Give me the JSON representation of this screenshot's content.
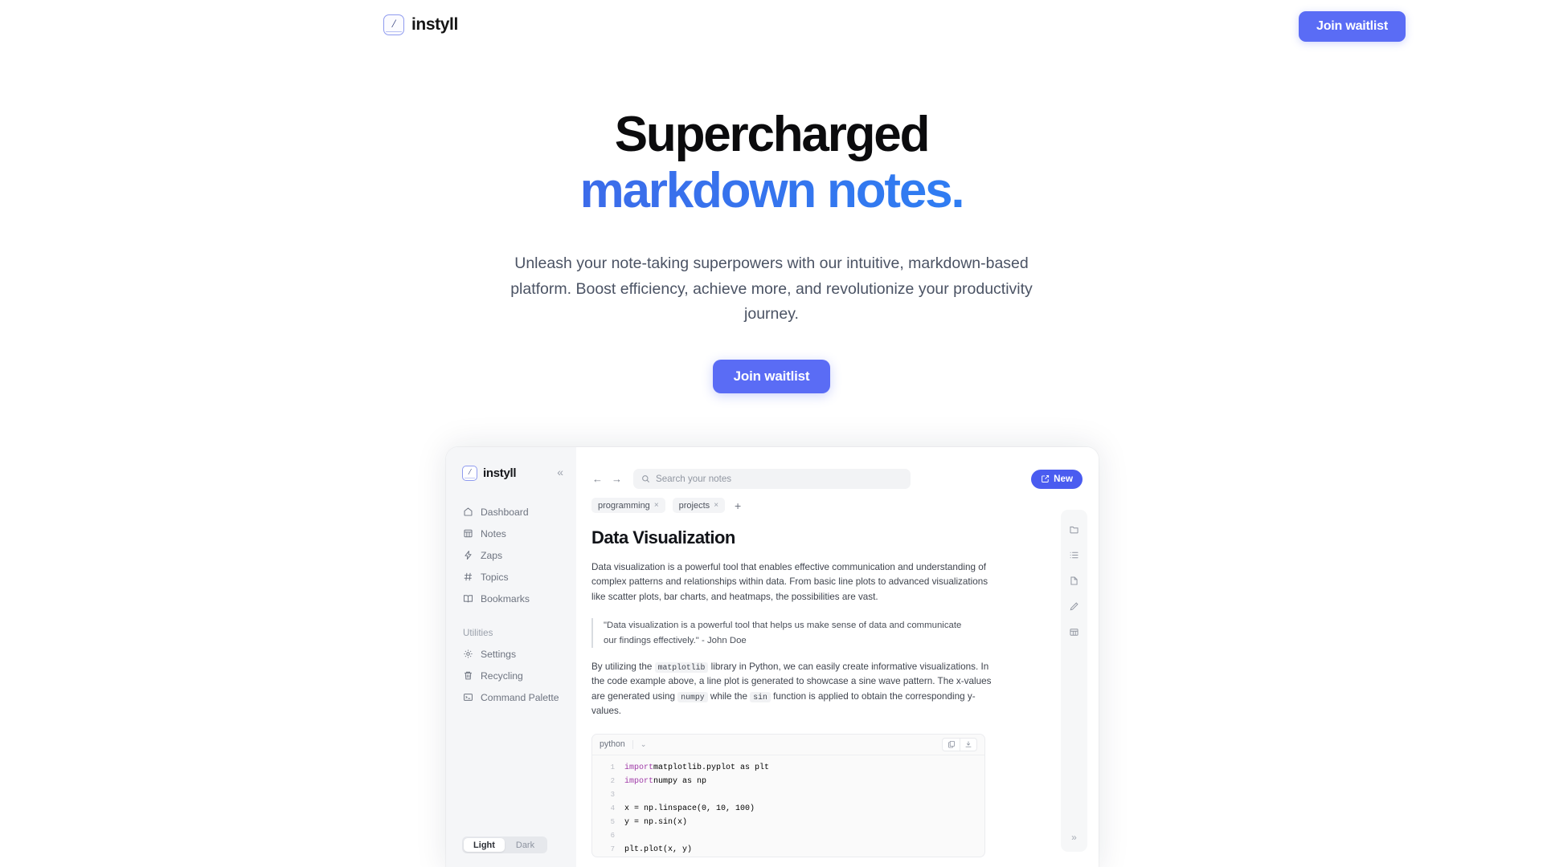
{
  "site": {
    "brand_name": "instyll",
    "logo_glyph": "/",
    "nav_cta_label": "Join waitlist"
  },
  "hero": {
    "headline_line1": "Supercharged",
    "headline_line2": "markdown notes.",
    "subheadline": "Unleash your note-taking superpowers with our intuitive, markdown-based platform. Boost efficiency, achieve more, and revolutionize your productivity journey.",
    "cta_label": "Join waitlist",
    "accent_color": "#5a6cf5",
    "gradient_from": "#2f4fd8",
    "gradient_to": "#1b8df8"
  },
  "app": {
    "brand_name": "instyll",
    "logo_glyph": "/",
    "collapse_icon": "«",
    "nav_items": [
      {
        "label": "Dashboard",
        "icon": "home-icon"
      },
      {
        "label": "Notes",
        "icon": "grid-icon"
      },
      {
        "label": "Zaps",
        "icon": "lightning-icon"
      },
      {
        "label": "Topics",
        "icon": "hash-icon"
      },
      {
        "label": "Bookmarks",
        "icon": "book-icon"
      }
    ],
    "utilities_label": "Utilities",
    "utility_items": [
      {
        "label": "Settings",
        "icon": "gear-icon"
      },
      {
        "label": "Recycling",
        "icon": "trash-icon"
      },
      {
        "label": "Command Palette",
        "icon": "terminal-icon"
      }
    ],
    "theme": {
      "light_label": "Light",
      "dark_label": "Dark",
      "active": "Light"
    },
    "topbar": {
      "back_icon": "←",
      "forward_icon": "→",
      "search_placeholder": "Search your notes",
      "new_button_label": "New"
    },
    "tags": [
      {
        "label": "programming",
        "close": "×"
      },
      {
        "label": "projects",
        "close": "×"
      }
    ],
    "tag_add_icon": "+",
    "document": {
      "title": "Data Visualization",
      "paragraph_1": "Data visualization is a powerful tool that enables effective communication and understanding of complex patterns and relationships within data. From basic line plots to advanced visualizations like scatter plots, bar charts, and heatmaps, the possibilities are vast.",
      "quote": "\"Data visualization is a powerful tool that helps us make sense of data and communicate our findings effectively.\" - John Doe",
      "paragraph_2_part1": "By utilizing the",
      "inline_code_1": "matplotlib",
      "paragraph_2_part2": "library in Python, we can easily create informative visualizations. In the code example above, a line plot is generated to showcase a sine wave pattern. The x-values are generated using",
      "inline_code_2": "numpy",
      "paragraph_2_part3": "while the",
      "inline_code_3": "sin",
      "paragraph_2_part4": "function is applied to obtain the corresponding y-values."
    },
    "codeblock": {
      "language": "python",
      "chevron": "⌄",
      "copy_icon": "copy-icon",
      "download_icon": "download-icon",
      "lines": [
        {
          "n": "1",
          "kw": "import",
          "rest": " matplotlib.pyplot as plt"
        },
        {
          "n": "2",
          "kw": "import",
          "rest": " numpy as np"
        },
        {
          "n": "3",
          "kw": "",
          "rest": ""
        },
        {
          "n": "4",
          "kw": "",
          "rest": "x = np.linspace(0, 10, 100)"
        },
        {
          "n": "5",
          "kw": "",
          "rest": "y = np.sin(x)"
        },
        {
          "n": "6",
          "kw": "",
          "rest": ""
        },
        {
          "n": "7",
          "kw": "",
          "rest": "plt.plot(x, y)"
        }
      ]
    },
    "right_rail": [
      {
        "icon": "folder-icon"
      },
      {
        "icon": "list-icon"
      },
      {
        "icon": "document-icon"
      },
      {
        "icon": "pencil-icon"
      },
      {
        "icon": "table-icon"
      }
    ],
    "right_rail_expand_icon": "»"
  }
}
